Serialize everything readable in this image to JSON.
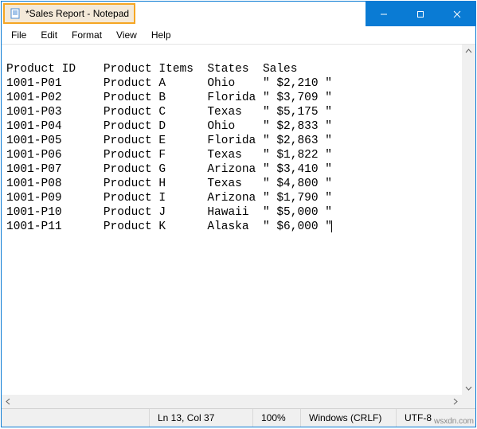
{
  "window": {
    "title": "*Sales Report - Notepad"
  },
  "menu": {
    "file": "File",
    "edit": "Edit",
    "format": "Format",
    "view": "View",
    "help": "Help"
  },
  "content": {
    "header": "Product ID    Product Items  States  Sales",
    "rows": [
      "1001-P01      Product A      Ohio    \" $2,210 \"",
      "1001-P02      Product B      Florida \" $3,709 \"",
      "1001-P03      Product C      Texas   \" $5,175 \"",
      "1001-P04      Product D      Ohio    \" $2,833 \"",
      "1001-P05      Product E      Florida \" $2,863 \"",
      "1001-P06      Product F      Texas   \" $1,822 \"",
      "1001-P07      Product G      Arizona \" $3,410 \"",
      "1001-P08      Product H      Texas   \" $4,800 \"",
      "1001-P09      Product I      Arizona \" $1,790 \"",
      "1001-P10      Product J      Hawaii  \" $5,000 \"",
      "1001-P11      Product K      Alaska  \" $6,000 \""
    ]
  },
  "status": {
    "position": "Ln 13, Col 37",
    "zoom": "100%",
    "lineend": "Windows (CRLF)",
    "encoding": "UTF-8"
  },
  "watermark": "wsxdn.com"
}
